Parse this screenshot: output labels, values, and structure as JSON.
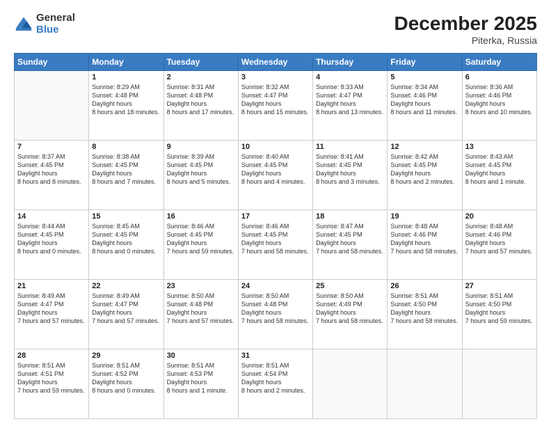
{
  "header": {
    "logo_general": "General",
    "logo_blue": "Blue",
    "title": "December 2025",
    "subtitle": "Piterka, Russia"
  },
  "columns": [
    "Sunday",
    "Monday",
    "Tuesday",
    "Wednesday",
    "Thursday",
    "Friday",
    "Saturday"
  ],
  "weeks": [
    [
      {
        "day": "",
        "empty": true
      },
      {
        "day": "1",
        "sunrise": "8:29 AM",
        "sunset": "4:48 PM",
        "daylight": "8 hours and 18 minutes."
      },
      {
        "day": "2",
        "sunrise": "8:31 AM",
        "sunset": "4:48 PM",
        "daylight": "8 hours and 17 minutes."
      },
      {
        "day": "3",
        "sunrise": "8:32 AM",
        "sunset": "4:47 PM",
        "daylight": "8 hours and 15 minutes."
      },
      {
        "day": "4",
        "sunrise": "8:33 AM",
        "sunset": "4:47 PM",
        "daylight": "8 hours and 13 minutes."
      },
      {
        "day": "5",
        "sunrise": "8:34 AM",
        "sunset": "4:46 PM",
        "daylight": "8 hours and 11 minutes."
      },
      {
        "day": "6",
        "sunrise": "8:36 AM",
        "sunset": "4:46 PM",
        "daylight": "8 hours and 10 minutes."
      }
    ],
    [
      {
        "day": "7",
        "sunrise": "8:37 AM",
        "sunset": "4:45 PM",
        "daylight": "8 hours and 8 minutes."
      },
      {
        "day": "8",
        "sunrise": "8:38 AM",
        "sunset": "4:45 PM",
        "daylight": "8 hours and 7 minutes."
      },
      {
        "day": "9",
        "sunrise": "8:39 AM",
        "sunset": "4:45 PM",
        "daylight": "8 hours and 5 minutes."
      },
      {
        "day": "10",
        "sunrise": "8:40 AM",
        "sunset": "4:45 PM",
        "daylight": "8 hours and 4 minutes."
      },
      {
        "day": "11",
        "sunrise": "8:41 AM",
        "sunset": "4:45 PM",
        "daylight": "8 hours and 3 minutes."
      },
      {
        "day": "12",
        "sunrise": "8:42 AM",
        "sunset": "4:45 PM",
        "daylight": "8 hours and 2 minutes."
      },
      {
        "day": "13",
        "sunrise": "8:43 AM",
        "sunset": "4:45 PM",
        "daylight": "8 hours and 1 minute."
      }
    ],
    [
      {
        "day": "14",
        "sunrise": "8:44 AM",
        "sunset": "4:45 PM",
        "daylight": "8 hours and 0 minutes."
      },
      {
        "day": "15",
        "sunrise": "8:45 AM",
        "sunset": "4:45 PM",
        "daylight": "8 hours and 0 minutes."
      },
      {
        "day": "16",
        "sunrise": "8:46 AM",
        "sunset": "4:45 PM",
        "daylight": "7 hours and 59 minutes."
      },
      {
        "day": "17",
        "sunrise": "8:46 AM",
        "sunset": "4:45 PM",
        "daylight": "7 hours and 58 minutes."
      },
      {
        "day": "18",
        "sunrise": "8:47 AM",
        "sunset": "4:45 PM",
        "daylight": "7 hours and 58 minutes."
      },
      {
        "day": "19",
        "sunrise": "8:48 AM",
        "sunset": "4:46 PM",
        "daylight": "7 hours and 58 minutes."
      },
      {
        "day": "20",
        "sunrise": "8:48 AM",
        "sunset": "4:46 PM",
        "daylight": "7 hours and 57 minutes."
      }
    ],
    [
      {
        "day": "21",
        "sunrise": "8:49 AM",
        "sunset": "4:47 PM",
        "daylight": "7 hours and 57 minutes."
      },
      {
        "day": "22",
        "sunrise": "8:49 AM",
        "sunset": "4:47 PM",
        "daylight": "7 hours and 57 minutes."
      },
      {
        "day": "23",
        "sunrise": "8:50 AM",
        "sunset": "4:48 PM",
        "daylight": "7 hours and 57 minutes."
      },
      {
        "day": "24",
        "sunrise": "8:50 AM",
        "sunset": "4:48 PM",
        "daylight": "7 hours and 58 minutes."
      },
      {
        "day": "25",
        "sunrise": "8:50 AM",
        "sunset": "4:49 PM",
        "daylight": "7 hours and 58 minutes."
      },
      {
        "day": "26",
        "sunrise": "8:51 AM",
        "sunset": "4:50 PM",
        "daylight": "7 hours and 58 minutes."
      },
      {
        "day": "27",
        "sunrise": "8:51 AM",
        "sunset": "4:50 PM",
        "daylight": "7 hours and 59 minutes."
      }
    ],
    [
      {
        "day": "28",
        "sunrise": "8:51 AM",
        "sunset": "4:51 PM",
        "daylight": "7 hours and 59 minutes."
      },
      {
        "day": "29",
        "sunrise": "8:51 AM",
        "sunset": "4:52 PM",
        "daylight": "8 hours and 0 minutes."
      },
      {
        "day": "30",
        "sunrise": "8:51 AM",
        "sunset": "4:53 PM",
        "daylight": "8 hours and 1 minute."
      },
      {
        "day": "31",
        "sunrise": "8:51 AM",
        "sunset": "4:54 PM",
        "daylight": "8 hours and 2 minutes."
      },
      {
        "day": "",
        "empty": true
      },
      {
        "day": "",
        "empty": true
      },
      {
        "day": "",
        "empty": true
      }
    ]
  ]
}
